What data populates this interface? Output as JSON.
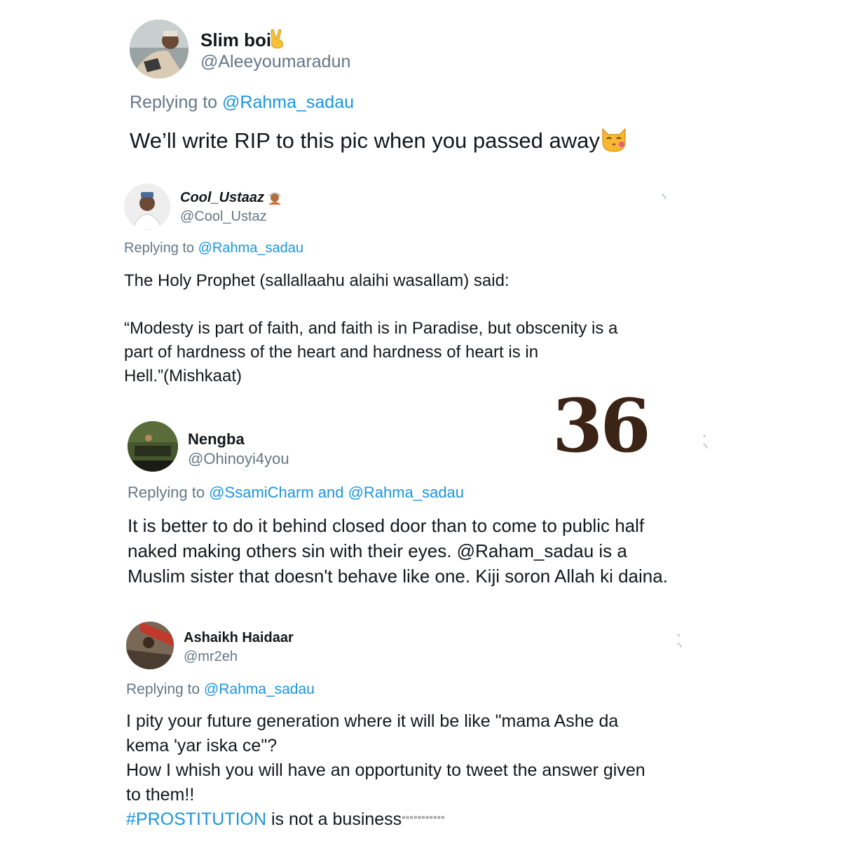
{
  "page_number": "36",
  "tweets": [
    {
      "name": "Slim boi",
      "name_emoji": "victory-hand-emoji",
      "handle": "@Aleeyoumaradun",
      "replying_prefix": "Replying to",
      "replying_to": "@Rahma_sadau",
      "body": [
        "We’ll write RIP to this pic when you passed away"
      ],
      "body_emoji": "kissing-cat-emoji"
    },
    {
      "name": "Cool_Ustaaz",
      "name_emoji": "man-with-turban-emoji",
      "handle": "@Cool_Ustaz",
      "replying_prefix": "Replying to",
      "replying_to": "@Rahma_sadau",
      "body": [
        "The Holy Prophet (sallallaahu alaihi wasallam) said:",
        "",
        "“Modesty is part of faith, and faith is in Paradise, but obscenity is a",
        "part of hardness of the heart and hardness of heart is in",
        "Hell.”(Mishkaat)"
      ]
    },
    {
      "name": "Nengba",
      "handle": "@Ohinoyi4you",
      "replying_prefix": "Replying to",
      "replying_to": "@SsamiCharm and @Rahma_sadau",
      "body": [
        "It is better to do it behind closed door than to come to public half",
        "naked making others sin with their eyes. @Raham_sadau is a",
        "Muslim sister that doesn't behave like one. Kiji soron Allah ki daina."
      ]
    },
    {
      "name": "Ashaikh Haidaar",
      "handle": "@mr2eh",
      "replying_prefix": "Replying to",
      "replying_to": "@Rahma_sadau",
      "body": [
        "I  pity your future generation where it will be like \"mama Ashe da",
        "kema 'yar iska ce\"?",
        "How I whish you will have an opportunity to tweet the answer given",
        "to them!!"
      ],
      "hashtag": "#PROSTITUTION",
      "hashtag_suffix": " is not a business",
      "trailing_dots": "°°°°°°°°°°°"
    }
  ]
}
